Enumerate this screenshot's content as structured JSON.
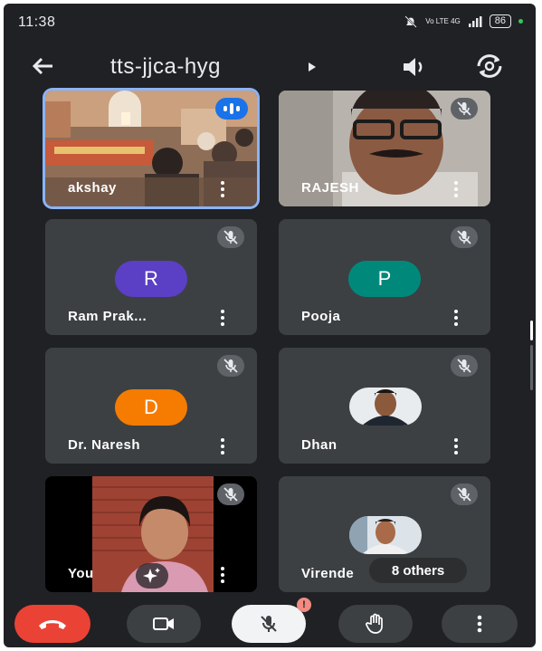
{
  "status_bar": {
    "time": "11:38",
    "signal_text": "Vo LTE 4G",
    "battery": "86"
  },
  "top_bar": {
    "meeting_code": "tts-jjca-hyg"
  },
  "participants": [
    {
      "name": "akshay",
      "mic": "speaking",
      "video": "camera"
    },
    {
      "name": "RAJESH",
      "mic": "muted",
      "video": "camera"
    },
    {
      "name": "Ram Prak...",
      "mic": "muted",
      "initial": "R",
      "color": "#5b3fc4"
    },
    {
      "name": "Pooja",
      "mic": "muted",
      "initial": "P",
      "color": "#00897b"
    },
    {
      "name": "Dr. Naresh",
      "mic": "muted",
      "initial": "D",
      "color": "#f57c00"
    },
    {
      "name": "Dhan",
      "mic": "muted",
      "video": "photo"
    },
    {
      "name": "You",
      "mic": "muted",
      "video": "camera"
    },
    {
      "name": "Virende",
      "mic": "muted",
      "video": "photo",
      "others_label": "8 others"
    }
  ],
  "controls": {
    "end_call_color": "#ea4335",
    "mic_badge": "!"
  }
}
